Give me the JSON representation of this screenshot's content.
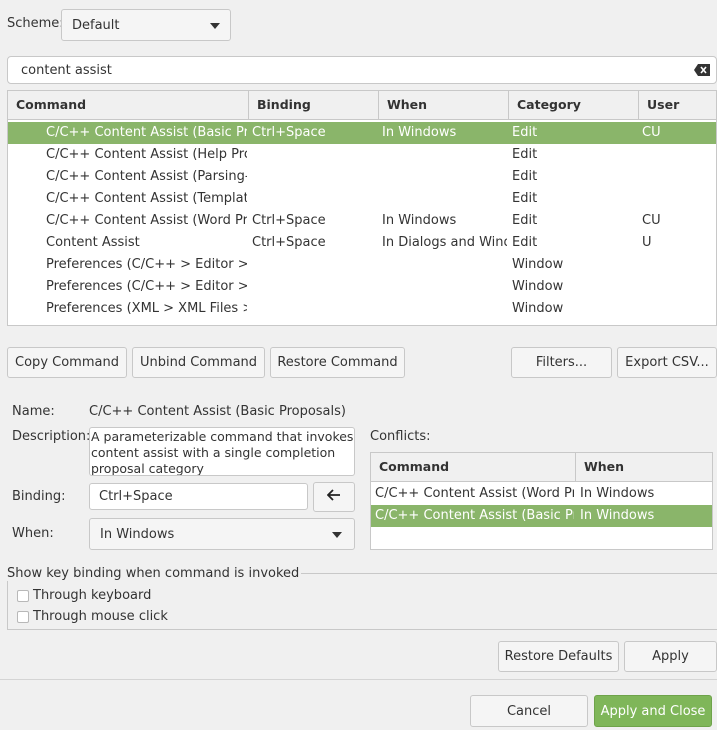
{
  "scheme": {
    "label": "Scheme:",
    "value": "Default"
  },
  "filter": {
    "value": "content assist"
  },
  "bindings_table": {
    "headers": [
      "Command",
      "Binding",
      "When",
      "Category",
      "User"
    ],
    "rows": [
      {
        "command": "C/C++ Content Assist (Basic Proposals)",
        "binding": "Ctrl+Space",
        "when": "In Windows",
        "category": "Edit",
        "user": "CU"
      },
      {
        "command": "C/C++ Content Assist (Help Proposals)",
        "binding": "",
        "when": "",
        "category": "Edit",
        "user": ""
      },
      {
        "command": "C/C++ Content Assist (Parsing-based Proposals)",
        "binding": "",
        "when": "",
        "category": "Edit",
        "user": ""
      },
      {
        "command": "C/C++ Content Assist (Template Proposals)",
        "binding": "",
        "when": "",
        "category": "Edit",
        "user": ""
      },
      {
        "command": "C/C++ Content Assist (Word Proposals)",
        "binding": "Ctrl+Space",
        "when": "In Windows",
        "category": "Edit",
        "user": "CU"
      },
      {
        "command": "Content Assist",
        "binding": "Ctrl+Space",
        "when": "In Dialogs and Windows",
        "category": "Edit",
        "user": "U"
      },
      {
        "command": "Preferences (C/C++ > Editor > Content Assist)",
        "binding": "",
        "when": "",
        "category": "Window",
        "user": ""
      },
      {
        "command": "Preferences (C/C++ > Editor > Content Assist > Advanced)",
        "binding": "",
        "when": "",
        "category": "Window",
        "user": ""
      },
      {
        "command": "Preferences (XML > XML Files > Editor > Content Assist)",
        "binding": "",
        "when": "",
        "category": "Window",
        "user": ""
      }
    ]
  },
  "actions": {
    "copy": "Copy Command",
    "unbind": "Unbind Command",
    "restore": "Restore Command",
    "filters": "Filters...",
    "export": "Export CSV..."
  },
  "details": {
    "name_label": "Name:",
    "name_value": "C/C++ Content Assist (Basic Proposals)",
    "description_label": "Description:",
    "description_value": "A parameterizable command that invokes content assist with a single completion proposal category",
    "binding_label": "Binding:",
    "binding_value": "Ctrl+Space",
    "when_label": "When:",
    "when_value": "In Windows"
  },
  "conflicts": {
    "label": "Conflicts:",
    "headers": [
      "Command",
      "When"
    ],
    "rows": [
      {
        "command": "C/C++ Content Assist (Word Proposals)",
        "when": "In Windows"
      },
      {
        "command": "C/C++ Content Assist (Basic Proposals)",
        "when": "In Windows"
      }
    ]
  },
  "show_binding": {
    "title": "Show key binding when command is invoked",
    "keyboard": "Through keyboard",
    "mouse": "Through mouse click"
  },
  "footer": {
    "restore_defaults": "Restore Defaults",
    "apply": "Apply",
    "cancel": "Cancel",
    "apply_close": "Apply and Close"
  },
  "colors": {
    "selection": "#8ab56a",
    "primary_button": "#7fb659"
  }
}
